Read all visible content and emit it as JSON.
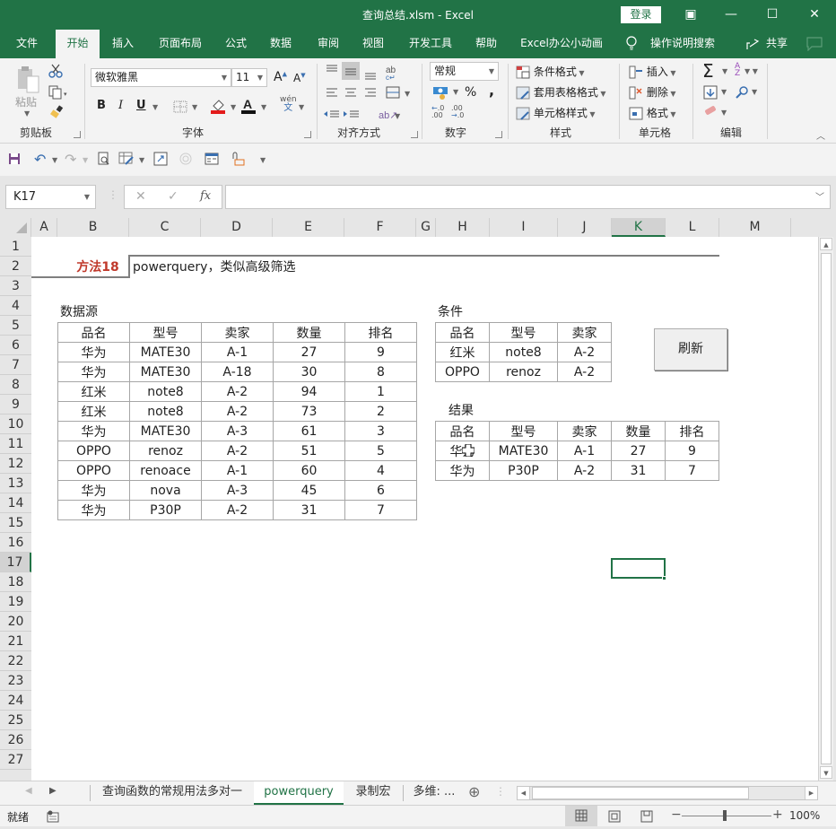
{
  "window": {
    "title": "查询总结.xlsm  -  Excel",
    "login_label": "登录",
    "controls": {
      "ribbon_display": "▣",
      "minimize": "—",
      "maximize": "☐",
      "close": "✕"
    }
  },
  "menu": {
    "tabs": [
      "文件",
      "开始",
      "插入",
      "页面布局",
      "公式",
      "数据",
      "审阅",
      "视图",
      "开发工具",
      "帮助",
      "Excel办公小动画"
    ],
    "active": "开始",
    "search_label": "操作说明搜索",
    "share_label": "共享"
  },
  "ribbon": {
    "clipboard": {
      "label": "剪贴板",
      "paste": "粘贴"
    },
    "font": {
      "label": "字体",
      "font_name": "微软雅黑",
      "font_size": "11",
      "bold": "B",
      "italic": "I",
      "underline": "U",
      "phonetic_top": "wén",
      "phonetic_bottom": "文",
      "grow": "A",
      "shrink": "A",
      "font_color_hex": "#cc2200",
      "highlight_hex": "#e31b1b"
    },
    "alignment": {
      "label": "对齐方式"
    },
    "number": {
      "label": "数字",
      "format": "常规",
      "percent": "%",
      "comma": ",",
      "inc_decimal_top": ".0",
      "inc_decimal_bottom": ".00",
      "dec_decimal_top": ".00",
      "dec_decimal_bottom": ".0"
    },
    "styles": {
      "label": "样式",
      "conditional": "条件格式",
      "table": "套用表格格式",
      "cell_styles": "单元格样式"
    },
    "cells": {
      "label": "单元格",
      "insert": "插入",
      "delete": "删除",
      "format": "格式"
    },
    "editing": {
      "label": "编辑",
      "sum": "Σ",
      "sort": "A/Z",
      "find": "⌕"
    }
  },
  "formula_bar": {
    "name_box": "K17",
    "cancel": "✕",
    "enter": "✓",
    "fx": "fx",
    "value": ""
  },
  "grid": {
    "columns": [
      "A",
      "B",
      "C",
      "D",
      "E",
      "F",
      "G",
      "H",
      "I",
      "J",
      "K",
      "L",
      "M"
    ],
    "selected_column": "K",
    "rows": [
      "1",
      "2",
      "3",
      "4",
      "5",
      "6",
      "7",
      "8",
      "9",
      "10",
      "11",
      "12",
      "13",
      "14",
      "15",
      "16",
      "17",
      "18",
      "19",
      "20",
      "21",
      "22",
      "23",
      "24",
      "25",
      "26",
      "27"
    ],
    "selected_row": "17",
    "active_cell": "K17"
  },
  "sheet": {
    "method_label": "方法18",
    "method_color": "#c0392b",
    "method_desc": "powerquery，类似高级筛选",
    "source_title": "数据源",
    "source_headers": [
      "品名",
      "型号",
      "卖家",
      "数量",
      "排名"
    ],
    "source_rows": [
      [
        "华为",
        "MATE30",
        "A-1",
        "27",
        "9"
      ],
      [
        "华为",
        "MATE30",
        "A-18",
        "30",
        "8"
      ],
      [
        "红米",
        "note8",
        "A-2",
        "94",
        "1"
      ],
      [
        "红米",
        "note8",
        "A-2",
        "73",
        "2"
      ],
      [
        "华为",
        "MATE30",
        "A-3",
        "61",
        "3"
      ],
      [
        "OPPO",
        "renoz",
        "A-2",
        "51",
        "5"
      ],
      [
        "OPPO",
        "renoace",
        "A-1",
        "60",
        "4"
      ],
      [
        "华为",
        "nova",
        "A-3",
        "45",
        "6"
      ],
      [
        "华为",
        "P30P",
        "A-2",
        "31",
        "7"
      ]
    ],
    "criteria_title": "条件",
    "criteria_headers": [
      "品名",
      "型号",
      "卖家"
    ],
    "criteria_rows": [
      [
        "红米",
        "note8",
        "A-2"
      ],
      [
        "OPPO",
        "renoz",
        "A-2"
      ]
    ],
    "refresh_label": "刷新",
    "result_title": "结果",
    "result_headers": [
      "品名",
      "型号",
      "卖家",
      "数量",
      "排名"
    ],
    "result_rows": [
      [
        "华为",
        "MATE30",
        "A-1",
        "27",
        "9"
      ],
      [
        "华为",
        "P30P",
        "A-2",
        "31",
        "7"
      ]
    ]
  },
  "sheet_tabs": {
    "tabs": [
      "查询函数的常规用法多对一",
      "powerquery",
      "录制宏",
      "多维: ..."
    ],
    "active": "powerquery",
    "add": "⊕"
  },
  "status": {
    "ready": "就绪",
    "zoom": "100%",
    "zoom_minus": "−",
    "zoom_plus": "+"
  },
  "colors": {
    "brand": "#217346"
  }
}
